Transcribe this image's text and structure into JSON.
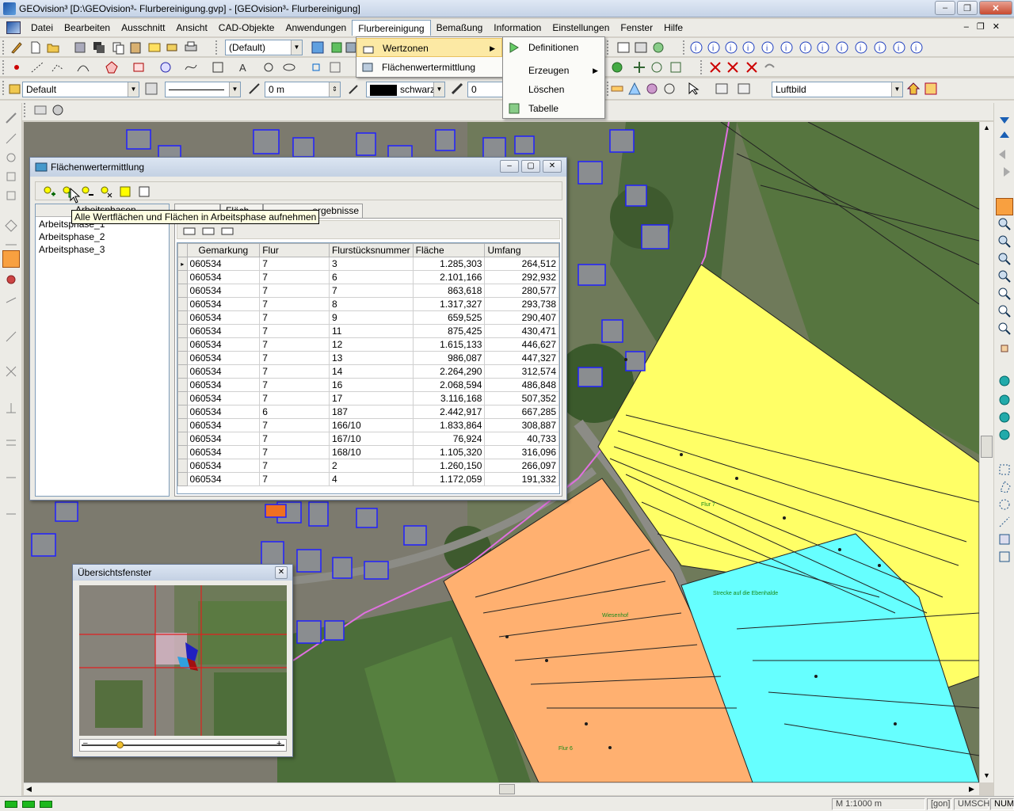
{
  "window": {
    "title": "GEOvision³  [D:\\GEOvision³- Flurbereinigung.gvp] - [GEOvision³- Flurbereinigung]"
  },
  "menu": {
    "items": [
      "Datei",
      "Bearbeiten",
      "Ausschnitt",
      "Ansicht",
      "CAD-Objekte",
      "Anwendungen",
      "Flurbereinigung",
      "Bemaßung",
      "Information",
      "Einstellungen",
      "Fenster",
      "Hilfe"
    ],
    "active": "Flurbereinigung"
  },
  "flurbereinigung_menu": {
    "items": [
      {
        "label": "Wertzonen",
        "has_submenu": true,
        "icon": "wertzonen-icon"
      },
      {
        "label": "Flächenwertermittlung",
        "has_submenu": false,
        "icon": "flaechenwert-icon"
      }
    ]
  },
  "wertzonen_menu": {
    "items": [
      {
        "label": "Definitionen",
        "has_submenu": false,
        "icon": "definitionen-icon"
      },
      {
        "label": "Erzeugen",
        "has_submenu": true,
        "icon": ""
      },
      {
        "label": "Löschen",
        "has_submenu": false,
        "icon": ""
      },
      {
        "label": "Tabelle",
        "has_submenu": false,
        "icon": "tabelle-icon"
      }
    ]
  },
  "toolbars": {
    "layer_combo": "(Default)",
    "style_combo": "Default",
    "offset_value": "0 m",
    "color_name": "schwarz",
    "width_value": "0",
    "background_combo": "Luftbild"
  },
  "flaechen_dialog": {
    "title": "Flächenwertermittlung",
    "tooltip": "Alle Wertflächen und Flächen in Arbeitsphase aufnehmen",
    "phases_header": "Arbeitsphasen",
    "phases": [
      "Arbeitsphase_1",
      "Arbeitsphase_2",
      "Arbeitsphase_3"
    ],
    "tabs": [
      "Arbeitsphasen",
      "Fläche",
      "Berechnungsergebnisse"
    ],
    "tab_visible_text": [
      "Fläch",
      "ergebnisse"
    ],
    "columns": [
      "Gemarkung",
      "Flur",
      "Flurstücksnummer",
      "Fläche",
      "Umfang"
    ],
    "rows": [
      [
        "060534",
        "7",
        "3",
        "1.285,303",
        "264,512"
      ],
      [
        "060534",
        "7",
        "6",
        "2.101,166",
        "292,932"
      ],
      [
        "060534",
        "7",
        "7",
        "863,618",
        "280,577"
      ],
      [
        "060534",
        "7",
        "8",
        "1.317,327",
        "293,738"
      ],
      [
        "060534",
        "7",
        "9",
        "659,525",
        "290,407"
      ],
      [
        "060534",
        "7",
        "11",
        "875,425",
        "430,471"
      ],
      [
        "060534",
        "7",
        "12",
        "1.615,133",
        "446,627"
      ],
      [
        "060534",
        "7",
        "13",
        "986,087",
        "447,327"
      ],
      [
        "060534",
        "7",
        "14",
        "2.264,290",
        "312,574"
      ],
      [
        "060534",
        "7",
        "16",
        "2.068,594",
        "486,848"
      ],
      [
        "060534",
        "7",
        "17",
        "3.116,168",
        "507,352"
      ],
      [
        "060534",
        "6",
        "187",
        "2.442,917",
        "667,285"
      ],
      [
        "060534",
        "7",
        "166/10",
        "1.833,864",
        "308,887"
      ],
      [
        "060534",
        "7",
        "167/10",
        "76,924",
        "40,733"
      ],
      [
        "060534",
        "7",
        "168/10",
        "1.105,320",
        "316,096"
      ],
      [
        "060534",
        "7",
        "2",
        "1.260,150",
        "266,097"
      ],
      [
        "060534",
        "7",
        "4",
        "1.172,059",
        "191,332"
      ]
    ]
  },
  "overview_dialog": {
    "title": "Übersichtsfenster"
  },
  "map": {
    "labels": {
      "flur7": "Flur 7",
      "flur6": "Flur 6",
      "strassenname": "Wiesenhof",
      "strecke": "Strecke auf die Ebenhalde"
    },
    "colors": {
      "yellow_zone": "#ffff66",
      "orange_zone": "#ffb070",
      "cyan_zone": "#66ffff",
      "parcel_line": "#222222",
      "building_outline": "#2020ff"
    }
  },
  "statusbar": {
    "scale": "M 1:1000  m",
    "unit": "[gon]",
    "umsch": "UMSCH",
    "num": "NUM"
  }
}
